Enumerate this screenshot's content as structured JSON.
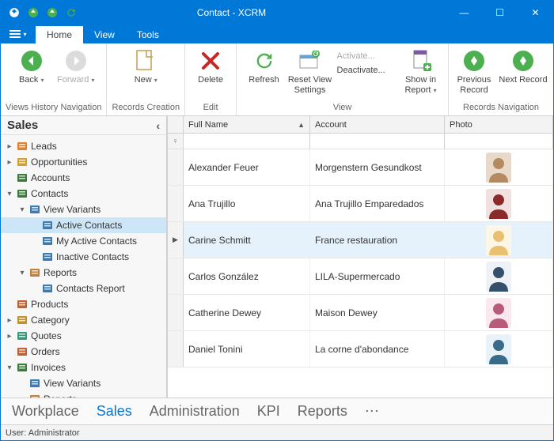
{
  "window": {
    "title": "Contact - XCRM"
  },
  "win_buttons": {
    "min": "—",
    "max": "☐",
    "close": "✕"
  },
  "tabs": {
    "home": "Home",
    "view": "View",
    "tools": "Tools"
  },
  "ribbon": {
    "groups": {
      "nav": {
        "label": "Views History Navigation",
        "back": "Back",
        "forward": "Forward"
      },
      "create": {
        "label": "Records Creation",
        "new": "New"
      },
      "edit": {
        "label": "Edit",
        "delete": "Delete"
      },
      "view": {
        "label": "View",
        "refresh": "Refresh",
        "reset": "Reset View\nSettings",
        "activate": "Activate...",
        "deactivate": "Deactivate...",
        "report": "Show in\nReport"
      },
      "recnav": {
        "label": "Records Navigation",
        "prev": "Previous\nRecord",
        "next": "Next Record"
      }
    }
  },
  "sidebar": {
    "title": "Sales",
    "tree": [
      {
        "indent": 0,
        "expander": "▸",
        "icon": "leads",
        "label": "Leads"
      },
      {
        "indent": 0,
        "expander": "▸",
        "icon": "opportunities",
        "label": "Opportunities"
      },
      {
        "indent": 0,
        "expander": "",
        "icon": "accounts",
        "label": "Accounts"
      },
      {
        "indent": 0,
        "expander": "▾",
        "icon": "contacts",
        "label": "Contacts"
      },
      {
        "indent": 1,
        "expander": "▾",
        "icon": "viewvariants",
        "label": "View Variants"
      },
      {
        "indent": 2,
        "expander": "",
        "icon": "list",
        "label": "Active Contacts",
        "selected": true
      },
      {
        "indent": 2,
        "expander": "",
        "icon": "list",
        "label": "My Active Contacts"
      },
      {
        "indent": 2,
        "expander": "",
        "icon": "list",
        "label": "Inactive Contacts"
      },
      {
        "indent": 1,
        "expander": "▾",
        "icon": "reports",
        "label": "Reports"
      },
      {
        "indent": 2,
        "expander": "",
        "icon": "list",
        "label": "Contacts Report"
      },
      {
        "indent": 0,
        "expander": "",
        "icon": "products",
        "label": "Products"
      },
      {
        "indent": 0,
        "expander": "▸",
        "icon": "category",
        "label": "Category"
      },
      {
        "indent": 0,
        "expander": "▸",
        "icon": "quotes",
        "label": "Quotes"
      },
      {
        "indent": 0,
        "expander": "",
        "icon": "orders",
        "label": "Orders"
      },
      {
        "indent": 0,
        "expander": "▾",
        "icon": "invoices",
        "label": "Invoices"
      },
      {
        "indent": 1,
        "expander": "",
        "icon": "list",
        "label": "View Variants"
      },
      {
        "indent": 1,
        "expander": "",
        "icon": "reports",
        "label": "Reports"
      }
    ]
  },
  "grid": {
    "columns": {
      "full": "Full Name",
      "account": "Account",
      "photo": "Photo"
    },
    "filter_glyph": "♀",
    "rows": [
      {
        "full": "Alexander Feuer",
        "account": "Morgenstern Gesundkost",
        "avatar_bg": "#e8d9c8",
        "avatar_color": "#b48a60"
      },
      {
        "full": "Ana Trujillo",
        "account": "Ana Trujillo Emparedados",
        "avatar_bg": "#f0e0e0",
        "avatar_color": "#8a2a2a"
      },
      {
        "full": "Carine Schmitt",
        "account": "France restauration",
        "avatar_bg": "#fdf5e6",
        "avatar_color": "#e8c070",
        "selected": true
      },
      {
        "full": "Carlos González",
        "account": "LILA-Supermercado",
        "avatar_bg": "#eef2f6",
        "avatar_color": "#35506b"
      },
      {
        "full": "Catherine Dewey",
        "account": "Maison Dewey",
        "avatar_bg": "#fbe8ee",
        "avatar_color": "#b85a7a"
      },
      {
        "full": "Daniel Tonini",
        "account": "La corne d'abondance",
        "avatar_bg": "#e8f2f8",
        "avatar_color": "#3a6a8a"
      }
    ]
  },
  "bottomnav": {
    "workplace": "Workplace",
    "sales": "Sales",
    "admin": "Administration",
    "kpi": "KPI",
    "reports": "Reports",
    "more": "⋯"
  },
  "status": {
    "user": "User: Administrator"
  }
}
